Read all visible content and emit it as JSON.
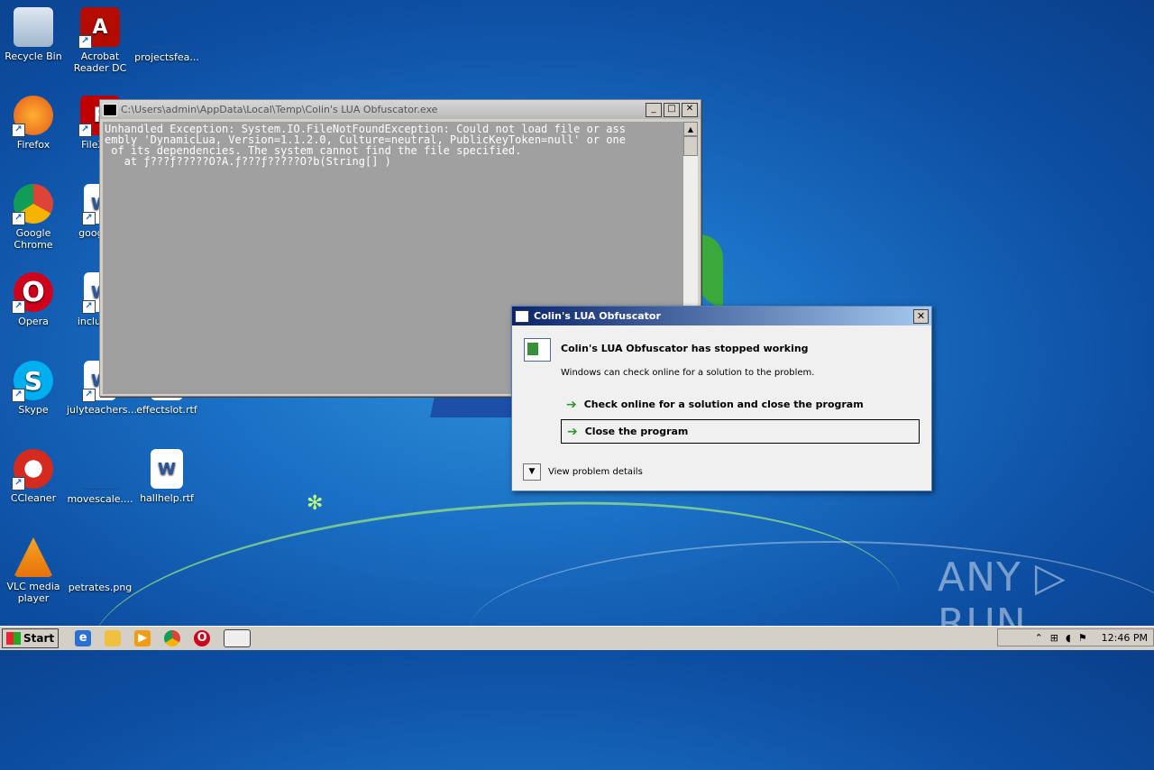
{
  "desktop": {
    "icons": [
      {
        "label": "Recycle Bin"
      },
      {
        "label": "Acrobat Reader DC"
      },
      {
        "label": "projectsfea..."
      },
      {
        "label": "Firefox"
      },
      {
        "label": "FileZilla"
      },
      {
        "label": "Google Chrome"
      },
      {
        "label": "google..."
      },
      {
        "label": "Opera"
      },
      {
        "label": "include..."
      },
      {
        "label": "Skype"
      },
      {
        "label": "julyteachers..."
      },
      {
        "label": "effectslot.rtf"
      },
      {
        "label": "CCleaner"
      },
      {
        "label": "movescale...."
      },
      {
        "label": "hallhelp.rtf"
      },
      {
        "label": "VLC media player"
      },
      {
        "label": "petrates.png"
      }
    ]
  },
  "console": {
    "title": "C:\\Users\\admin\\AppData\\Local\\Temp\\Colin's LUA Obfuscator.exe",
    "minimize": "_",
    "maximize": "□",
    "close": "✕",
    "output": "Unhandled Exception: System.IO.FileNotFoundException: Could not load file or ass\nembly 'DynamicLua, Version=1.1.2.0, Culture=neutral, PublicKeyToken=null' or one\n of its dependencies. The system cannot find the file specified.\n   at ƒ???ƒ?????O?A.ƒ???ƒ?????O?b(String[] )"
  },
  "dialog": {
    "title": "Colin's LUA Obfuscator",
    "close": "✕",
    "heading": "Colin's LUA Obfuscator has stopped working",
    "subtext": "Windows can check online for a solution to the problem.",
    "option_check_online": "Check online for a solution and close the program",
    "option_close": "Close the program",
    "details_label": "View problem details"
  },
  "watermark": "ANY ▷ RUN",
  "taskbar": {
    "start_label": "Start",
    "clock": "12:46 PM"
  }
}
